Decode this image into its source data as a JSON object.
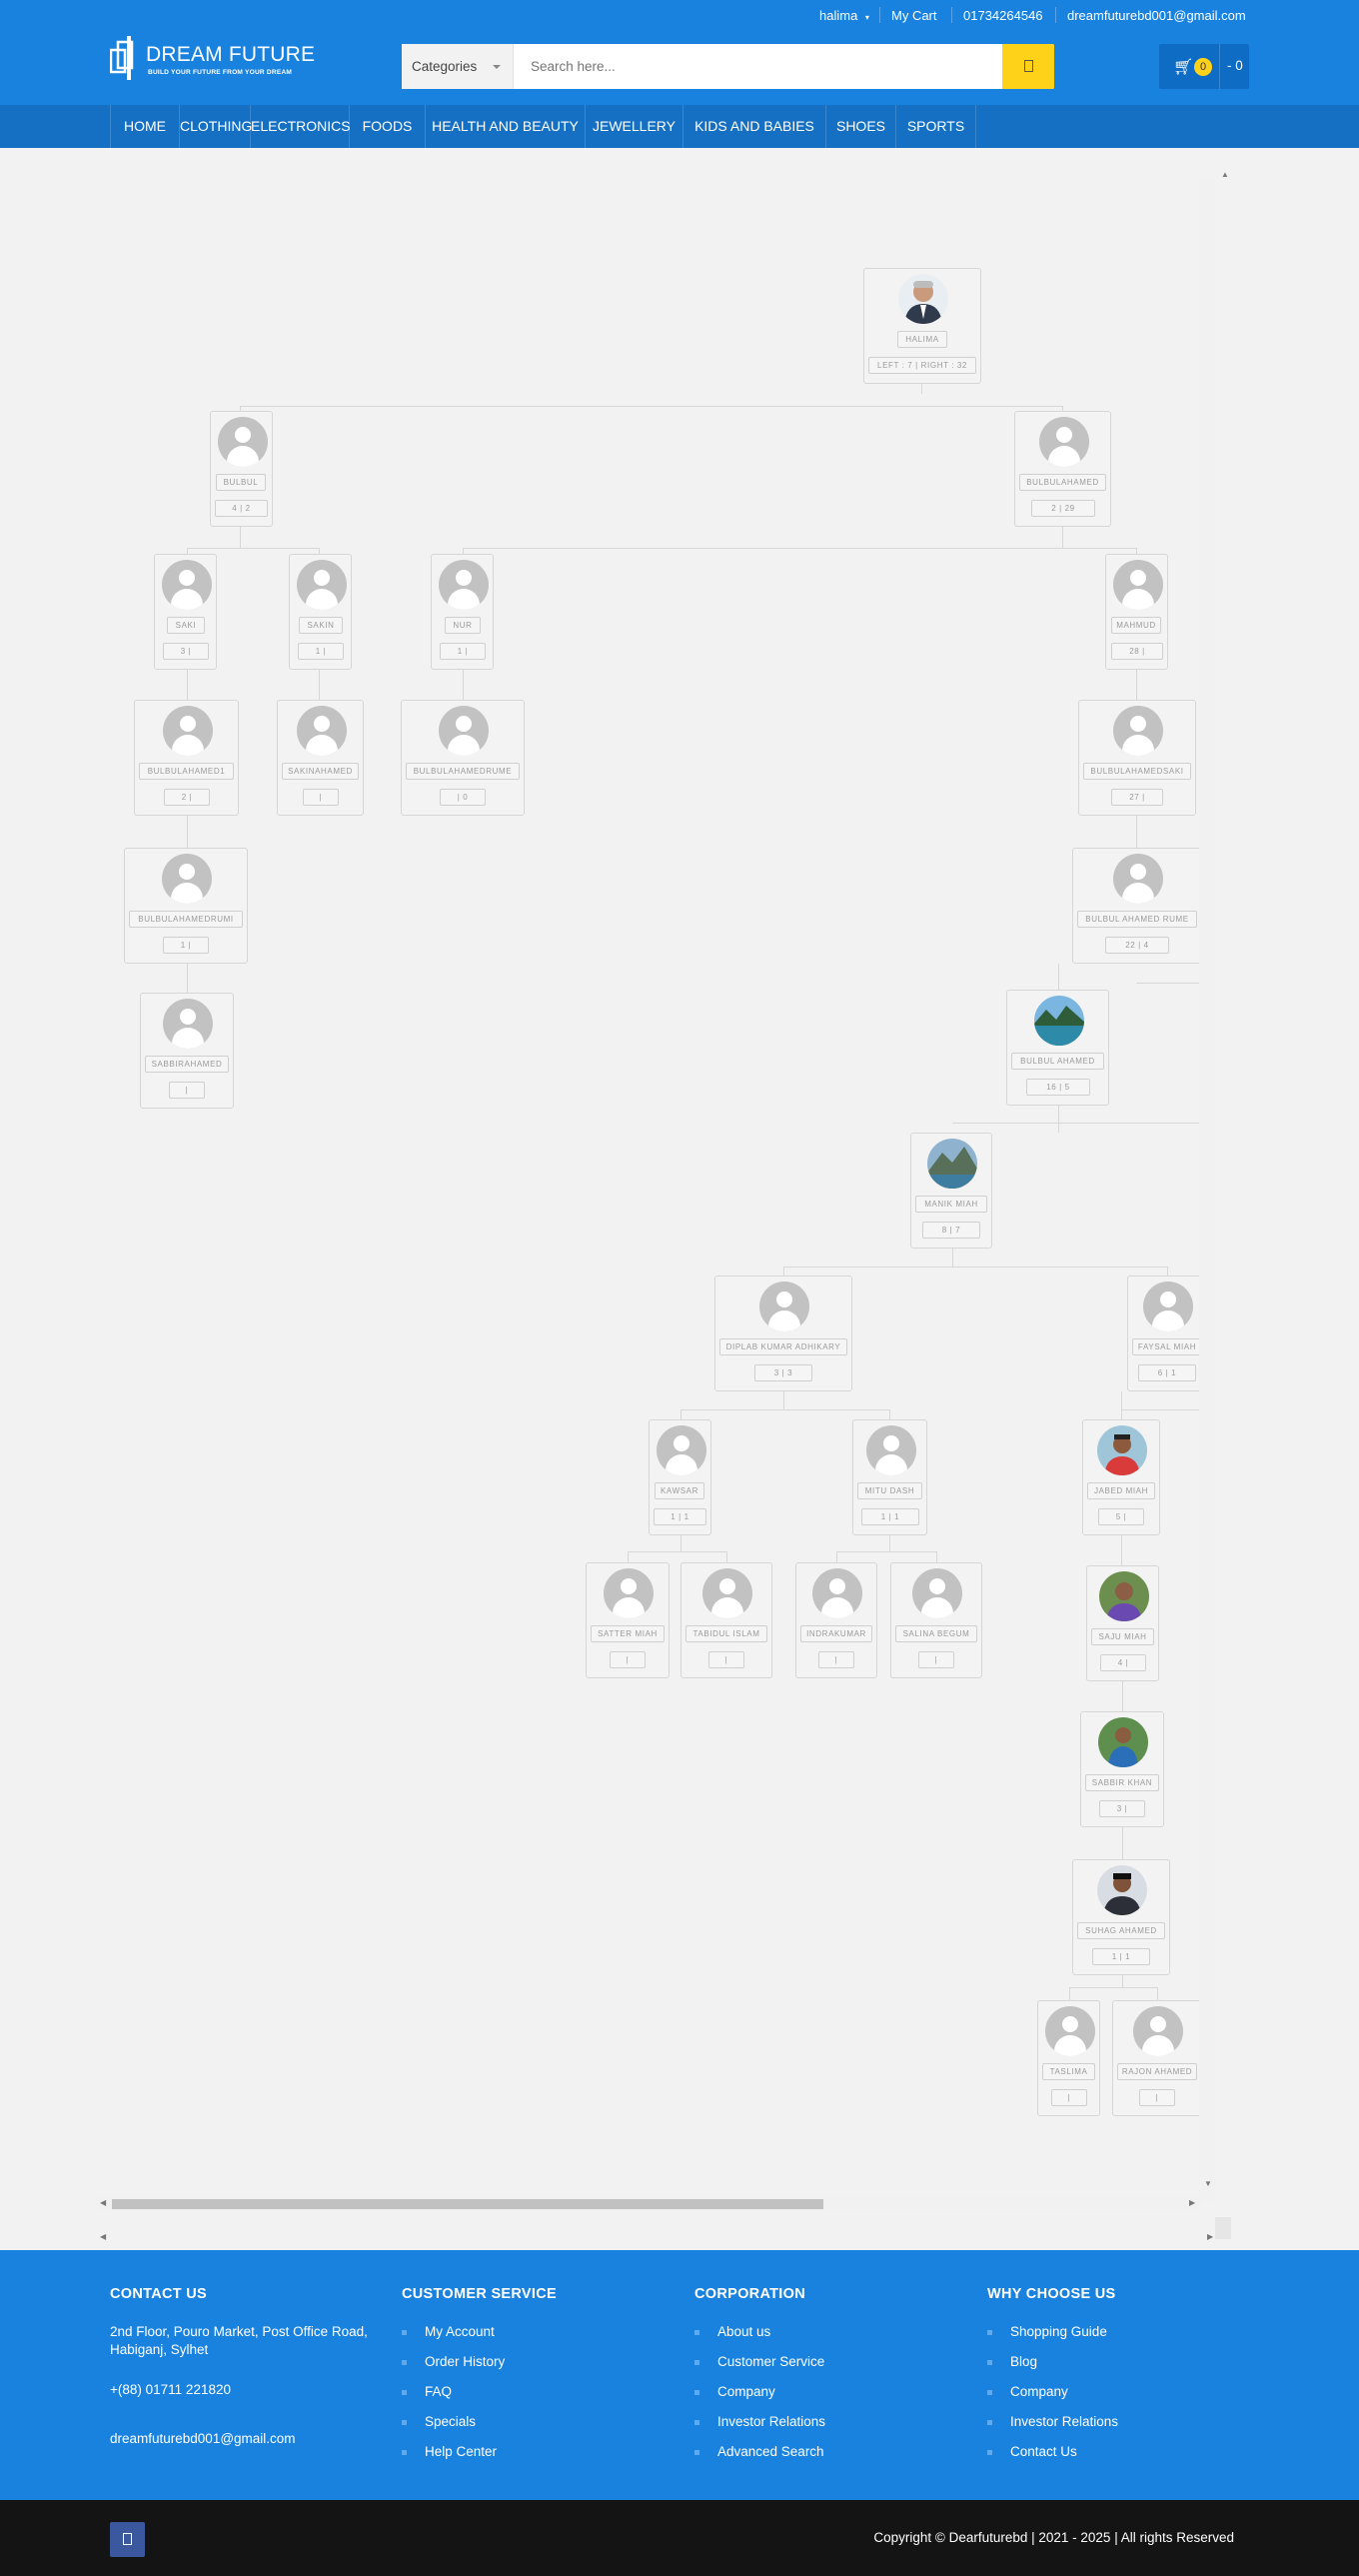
{
  "header": {
    "user": "halima",
    "my_cart": "My Cart",
    "phone": "01734264546",
    "email": "dreamfuturebd001@gmail.com",
    "logo_name": "DREAM FUTURE",
    "logo_tagline": "BUILD YOUR FUTURE FROM YOUR DREAM",
    "categories_label": "Categories",
    "search_placeholder": "Search here...",
    "cart_count": "0",
    "cart_total": "- 0"
  },
  "nav": [
    "HOME",
    "CLOTHING",
    "ELECTRONICS",
    "FOODS",
    "HEALTH AND BEAUTY",
    "JEWELLERY",
    "KIDS AND BABIES",
    "SHOES",
    "SPORTS"
  ],
  "tree": [
    {
      "name": "HALIMA",
      "stats": "LEFT : 7 | RIGHT : 32",
      "photo": "man-suit"
    },
    {
      "name": "BULBUL",
      "stats": "4 | 2",
      "photo": "default"
    },
    {
      "name": "BULBULAHAMED",
      "stats": "2 | 29",
      "photo": "default"
    },
    {
      "name": "SAKI",
      "stats": "3 |",
      "photo": "default"
    },
    {
      "name": "SAKIN",
      "stats": "1 |",
      "photo": "default"
    },
    {
      "name": "NUR",
      "stats": "1 |",
      "photo": "default"
    },
    {
      "name": "MAHMUD",
      "stats": "28 |",
      "photo": "default"
    },
    {
      "name": "BULBULAHAMED1",
      "stats": "2 |",
      "photo": "default"
    },
    {
      "name": "SAKINAHAMED",
      "stats": "|",
      "photo": "default"
    },
    {
      "name": "BULBULAHAMEDRUME",
      "stats": "| 0",
      "photo": "default"
    },
    {
      "name": "BULBULAHAMEDSAKI",
      "stats": "27 |",
      "photo": "default"
    },
    {
      "name": "BULBULAHAMEDRUMI",
      "stats": "1 |",
      "photo": "default"
    },
    {
      "name": "BULBUL AHAMED RUME",
      "stats": "22 | 4",
      "photo": "default"
    },
    {
      "name": "SABBIRAHAMED",
      "stats": "|",
      "photo": "default"
    },
    {
      "name": "BULBUL AHAMED",
      "stats": "16 | 5",
      "photo": "lake"
    },
    {
      "name": "MANIK MIAH",
      "stats": "8 | 7",
      "photo": "mountain"
    },
    {
      "name": "DIPLAB KUMAR ADHIKARY",
      "stats": "3 | 3",
      "photo": "default"
    },
    {
      "name": "FAYSAL MIAH",
      "stats": "6 | 1",
      "photo": "default"
    },
    {
      "name": "KAWSAR",
      "stats": "1 | 1",
      "photo": "default"
    },
    {
      "name": "MITU DASH",
      "stats": "1 | 1",
      "photo": "default"
    },
    {
      "name": "JABED MIAH",
      "stats": "5 |",
      "photo": "man-red"
    },
    {
      "name": "SATTER MIAH",
      "stats": "|",
      "photo": "default"
    },
    {
      "name": "TABIDUL ISLAM",
      "stats": "|",
      "photo": "default"
    },
    {
      "name": "INDRAKUMAR",
      "stats": "|",
      "photo": "default"
    },
    {
      "name": "SALINA BEGUM",
      "stats": "|",
      "photo": "default"
    },
    {
      "name": "SAJU MIAH",
      "stats": "4 |",
      "photo": "man-green"
    },
    {
      "name": "SABBIR KHAN",
      "stats": "3 |",
      "photo": "man-outdoor"
    },
    {
      "name": "SUHAG AHAMED",
      "stats": "1 | 1",
      "photo": "man-dark"
    },
    {
      "name": "TASLIMA",
      "stats": "|",
      "photo": "default"
    },
    {
      "name": "RAJON AHAMED",
      "stats": "|",
      "photo": "default"
    }
  ],
  "footer": {
    "contact": {
      "title": "CONTACT US",
      "address1": "2nd Floor, Pouro Market, Post Office Road,",
      "address2": "Habiganj, Sylhet",
      "phone": "+(88) 01711 221820",
      "email": "dreamfuturebd001@gmail.com"
    },
    "service": {
      "title": "CUSTOMER SERVICE",
      "items": [
        "My Account",
        "Order History",
        "FAQ",
        "Specials",
        "Help Center"
      ]
    },
    "corporation": {
      "title": "CORPORATION",
      "items": [
        "About us",
        "Customer Service",
        "Company",
        "Investor Relations",
        "Advanced Search"
      ]
    },
    "why": {
      "title": "WHY CHOOSE US",
      "items": [
        "Shopping Guide",
        "Blog",
        "Company",
        "Investor Relations",
        "Contact Us"
      ]
    }
  },
  "copyright": "Copyright © Dearfuturebd | 2021 - 2025 | All rights Reserved",
  "colors": {
    "primary": "#1982de",
    "nav": "#1570c4",
    "accent": "#ffd21a",
    "bottom": "#141414"
  }
}
